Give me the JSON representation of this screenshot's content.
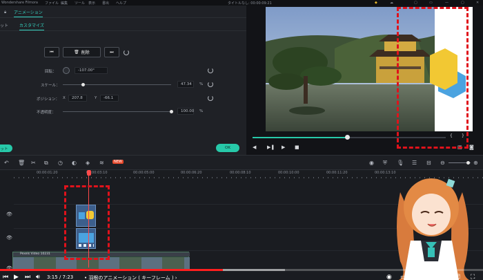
{
  "menubar": {
    "title": "Wondershare Filmora",
    "items": [
      "ファイル",
      "編集",
      "ツール",
      "表示",
      "書出",
      "ヘルプ"
    ],
    "project_title": "タイトルなし: 00:00:09:21"
  },
  "panel": {
    "tab_animation": "アニメーション",
    "tab_preset": "ット",
    "tab_custom": "カスタマイズ",
    "delete_button": "削除",
    "rotation": {
      "label": "回転：",
      "value": "-107.00°"
    },
    "scale": {
      "label": "スケール：",
      "value": "47.34",
      "unit": "%",
      "fraction": 0.19
    },
    "position": {
      "label": "ポジション：",
      "x_label": "X",
      "x_value": "207.8",
      "y_label": "Y",
      "y_value": "-66.1"
    },
    "opacity": {
      "label": "不透明度：",
      "value": "100.00",
      "unit": "%",
      "fraction": 1.0
    },
    "reset_button": "ット",
    "ok_button": "OK"
  },
  "preview": {
    "progress_fraction": 0.49
  },
  "timeline": {
    "ruler_labels": [
      "00:00:01:20",
      "00:00:03:10",
      "00:00:05:00",
      "00:00:06:20",
      "00:00:08:10",
      "00:00:10:00",
      "00:00:11:20",
      "00:00:13:10"
    ],
    "video_clip_label": "Pexels Video 10231",
    "new_badge": "NEW"
  },
  "youtube": {
    "time": "3:15 / 7:23",
    "chapter": "• 羽根のアニメーション ( キーフレーム ) ›"
  },
  "colors": {
    "accent": "#27c9a9",
    "highlight": "#e0121b",
    "playhead": "#ff4b4b"
  }
}
